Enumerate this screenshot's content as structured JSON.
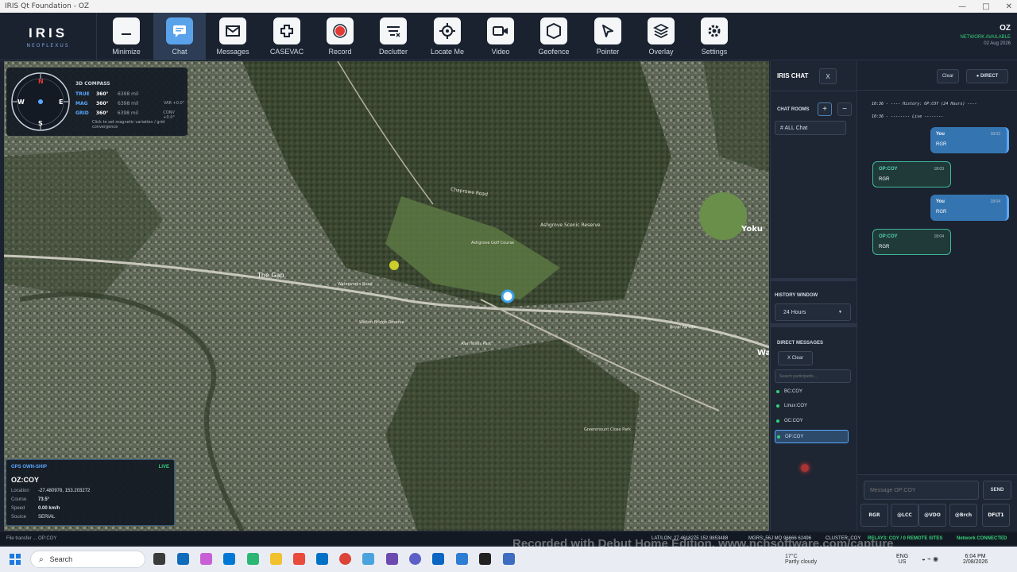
{
  "window": {
    "title": "IRIS Qt Foundation - OZ",
    "controls": [
      "—",
      "□",
      "✕"
    ]
  },
  "logo": {
    "title": "IRIS",
    "subtitle": "NEOPLEXUS"
  },
  "toolbar": {
    "buttons": [
      {
        "label": "Minimize",
        "icon": "minimize-icon"
      },
      {
        "label": "Chat",
        "icon": "chat-icon",
        "active": true
      },
      {
        "label": "Messages",
        "icon": "envelope-icon"
      },
      {
        "label": "CASEVAC",
        "icon": "medical-cross-icon"
      },
      {
        "label": "Record",
        "icon": "record-icon"
      },
      {
        "label": "Declutter",
        "icon": "declutter-icon"
      },
      {
        "label": "Locate Me",
        "icon": "crosshair-icon"
      },
      {
        "label": "Video",
        "icon": "video-camera-icon"
      },
      {
        "label": "Geofence",
        "icon": "geofence-icon"
      },
      {
        "label": "Pointer",
        "icon": "pointer-icon"
      },
      {
        "label": "Overlay",
        "icon": "layers-icon"
      },
      {
        "label": "Settings",
        "icon": "gear-icon"
      }
    ]
  },
  "top_status": {
    "callsign": "OZ",
    "network": "NETWORK AVAILABLE",
    "date": "02 Aug 2026"
  },
  "compass": {
    "title": "3D COMPASS",
    "cardinals": {
      "n": "N",
      "e": "E",
      "s": "S",
      "w": "W"
    },
    "rows": [
      {
        "key": "TRUE",
        "deg": "360°",
        "mil": "6398 mil",
        "extra": ""
      },
      {
        "key": "MAG",
        "deg": "360°",
        "mil": "6398 mil",
        "extra": "VAR +0.0°"
      },
      {
        "key": "GRID",
        "deg": "360°",
        "mil": "6398 mil",
        "extra": "CONV +0.0°"
      }
    ],
    "hint": "Click to set magnetic variation / grid convergence"
  },
  "map": {
    "labels": {
      "chaprowe": "Chaprowe Road",
      "ashgrove_reserve": "Ashgrove Scenic Reserve",
      "ashgrove_golf": "Ashgrove Golf Course",
      "the_gap": "The Gap",
      "walton_bridge": "Walton Bridge Reserve",
      "alan_wiles": "Alan Wiles Park",
      "royal_parade": "Royal Parade",
      "yoku": "Yoku",
      "waterworks": "Waterworks Road",
      "greenmount": "Greenmount Close Park",
      "wa": "Wa"
    }
  },
  "gps": {
    "title": "GPS OWN-SHIP",
    "live": "LIVE",
    "callsign": "OZ:COY",
    "rows": [
      {
        "key": "Location",
        "value": "-27.480978, 153.203272"
      },
      {
        "key": "Course",
        "value": "73.5°"
      },
      {
        "key": "Speed",
        "value": "0.00 km/h"
      },
      {
        "key": "Source",
        "value": "SERIAL"
      }
    ]
  },
  "chat_sidebar": {
    "title": "IRIS CHAT",
    "close": "X",
    "rooms_title": "CHAT ROOMS",
    "add": "+",
    "remove": "−",
    "rooms": [
      "# ALL Chat"
    ],
    "history_title": "HISTORY WINDOW",
    "history_value": "24 Hours",
    "dm_title": "DIRECT MESSAGES",
    "dm_clear": "X Clear",
    "dm_search_placeholder": "Search participants...",
    "participants": [
      "BC:COY",
      "Linux:COY",
      "OC:COY",
      "OP:COY"
    ]
  },
  "chat_main": {
    "clear": "Clear",
    "direct": "● DIRECT",
    "system_lines": [
      "10:36 - ---- History: OP:COY (24 Hours) ----",
      "10:36 - -------- Live --------"
    ],
    "messages": [
      {
        "from": "You",
        "time": "18:02",
        "text": "RGR",
        "mine": true
      },
      {
        "from": "OP:COY",
        "time": "18:03",
        "text": "RGR",
        "mine": false
      },
      {
        "from": "You",
        "time": "18:04",
        "text": "RGR",
        "mine": true
      },
      {
        "from": "OP:COY",
        "time": "18:04",
        "text": "RGR",
        "mine": false
      }
    ],
    "input_placeholder": "Message OP:COY",
    "send": "SEND",
    "quick": [
      "RGR",
      "@LCC",
      "@VDO",
      "@Brch",
      "DFLT1"
    ]
  },
  "statusbar": {
    "left": "File transfer ... OP:COY",
    "latlon": "LAT/LON: 27.4618275 152.9853488",
    "mgrs": "MGRS: 56J MQ 96666 62496",
    "cluster": "CLUSTER: COY",
    "relay": "RELAY3: COY / 0 REMOTE SITES",
    "network": "Network CONNECTED"
  },
  "watermark": "Recorded with Debut Home Edition. www.nchsoftware.com/capture",
  "taskbar": {
    "search": "Search",
    "weather_temp": "17°C",
    "weather_desc": "Partly cloudy",
    "lang1": "ENG",
    "lang2": "US",
    "time": "6:04 PM",
    "date": "2/08/2026"
  },
  "colors": {
    "accent": "#5aa3ea",
    "green": "#35d07a",
    "panel": "#1e2633"
  }
}
